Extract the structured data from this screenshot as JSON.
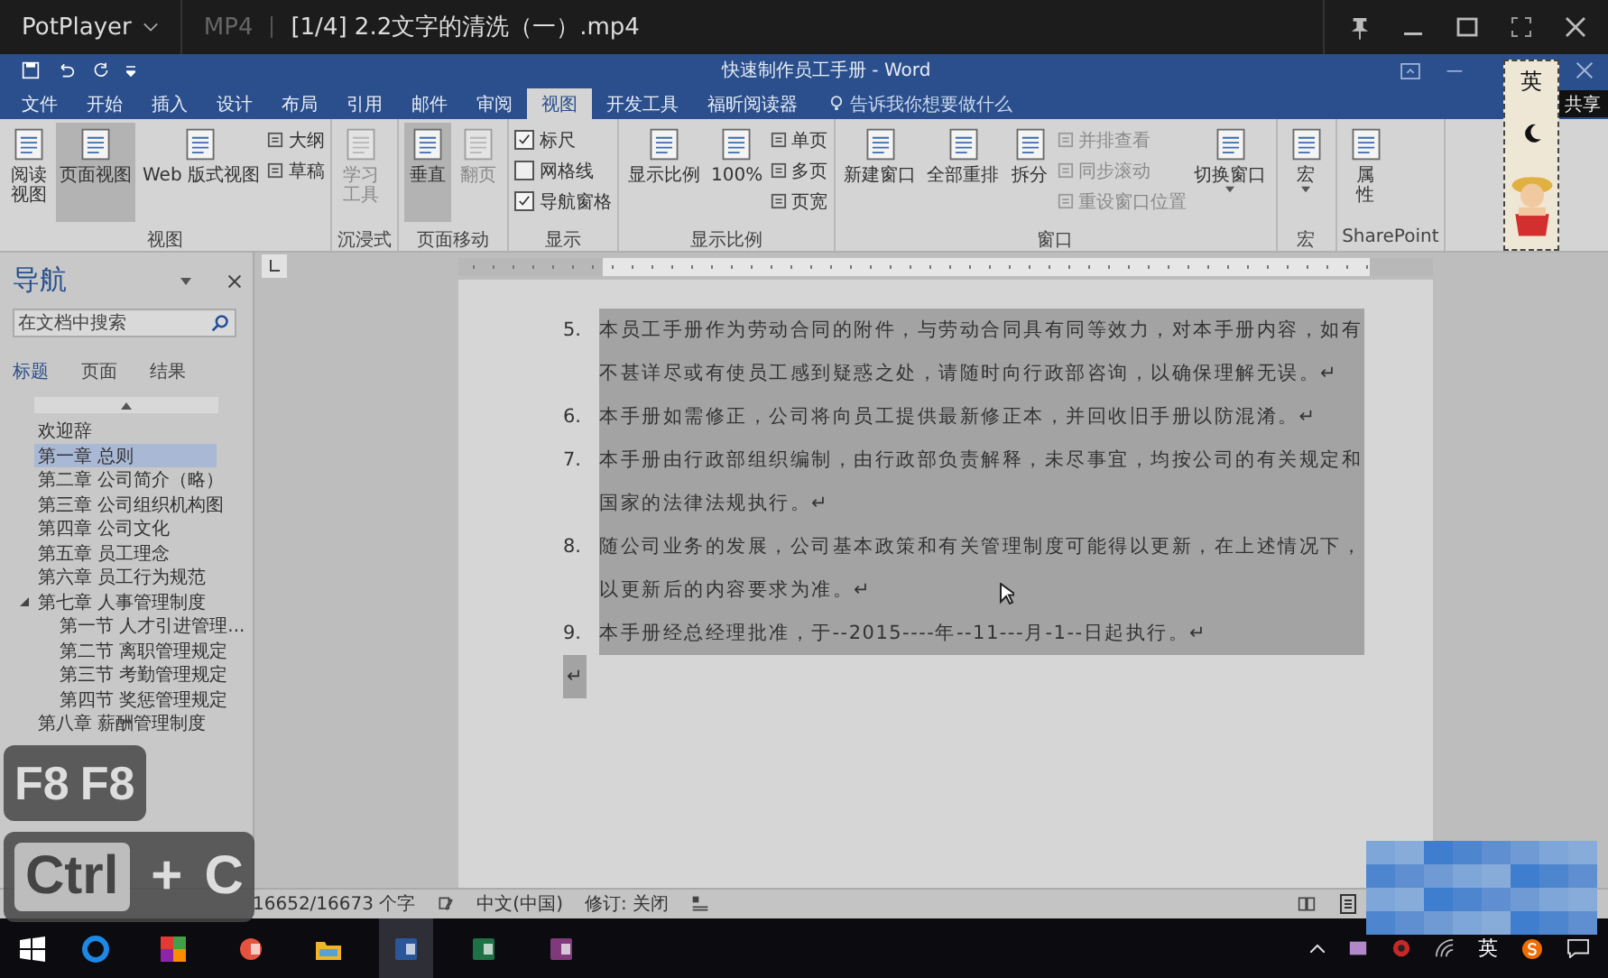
{
  "player": {
    "app": "PotPlayer",
    "format": "MP4",
    "file": "[1/4] 2.2文字的清洗（一）.mp4"
  },
  "word": {
    "title": "快速制作员工手册 - Word",
    "tell_me": "告诉我你想要做什么",
    "share": "共享",
    "tabs": [
      {
        "label": "文件",
        "selected": false
      },
      {
        "label": "开始",
        "selected": false
      },
      {
        "label": "插入",
        "selected": false
      },
      {
        "label": "设计",
        "selected": false
      },
      {
        "label": "布局",
        "selected": false
      },
      {
        "label": "引用",
        "selected": false
      },
      {
        "label": "邮件",
        "selected": false
      },
      {
        "label": "审阅",
        "selected": false
      },
      {
        "label": "视图",
        "selected": true
      },
      {
        "label": "开发工具",
        "selected": false
      },
      {
        "label": "福昕阅读器",
        "selected": false
      }
    ]
  },
  "ribbon": {
    "groups": [
      {
        "label": "视图",
        "items": [
          {
            "kind": "large",
            "lines": [
              "阅读",
              "视图"
            ],
            "selected": false,
            "disabled": false
          },
          {
            "kind": "large",
            "lines": [
              "页面视图"
            ],
            "selected": true,
            "disabled": false
          },
          {
            "kind": "large",
            "lines": [
              "Web 版式视图"
            ],
            "selected": false,
            "disabled": false
          },
          {
            "kind": "stack",
            "items": [
              {
                "kind": "small",
                "label": "大纲",
                "disabled": false
              },
              {
                "kind": "small",
                "label": "草稿",
                "disabled": false
              }
            ]
          }
        ]
      },
      {
        "label": "沉浸式",
        "items": [
          {
            "kind": "large",
            "lines": [
              "学习",
              "工具"
            ],
            "selected": false,
            "disabled": true
          }
        ]
      },
      {
        "label": "页面移动",
        "items": [
          {
            "kind": "large",
            "lines": [
              "垂直"
            ],
            "selected": true,
            "disabled": false
          },
          {
            "kind": "large",
            "lines": [
              "翻页"
            ],
            "selected": false,
            "disabled": true
          }
        ]
      },
      {
        "label": "显示",
        "items": [
          {
            "kind": "stack",
            "items": [
              {
                "kind": "check",
                "label": "标尺",
                "checked": true
              },
              {
                "kind": "check",
                "label": "网格线",
                "checked": false
              },
              {
                "kind": "check",
                "label": "导航窗格",
                "checked": true
              }
            ]
          }
        ]
      },
      {
        "label": "显示比例",
        "items": [
          {
            "kind": "large",
            "lines": [
              "显示比例"
            ],
            "selected": false,
            "disabled": false
          },
          {
            "kind": "large",
            "lines": [
              "100%"
            ],
            "selected": false,
            "disabled": false
          },
          {
            "kind": "stack",
            "items": [
              {
                "kind": "small",
                "label": "单页",
                "disabled": false
              },
              {
                "kind": "small",
                "label": "多页",
                "disabled": false
              },
              {
                "kind": "small",
                "label": "页宽",
                "disabled": false
              }
            ]
          }
        ]
      },
      {
        "label": "窗口",
        "items": [
          {
            "kind": "large",
            "lines": [
              "新建窗口"
            ],
            "selected": false,
            "disabled": false
          },
          {
            "kind": "large",
            "lines": [
              "全部重排"
            ],
            "selected": false,
            "disabled": false
          },
          {
            "kind": "large",
            "lines": [
              "拆分"
            ],
            "selected": false,
            "disabled": false
          },
          {
            "kind": "stack",
            "items": [
              {
                "kind": "small",
                "label": "并排查看",
                "disabled": true
              },
              {
                "kind": "small",
                "label": "同步滚动",
                "disabled": true
              },
              {
                "kind": "small",
                "label": "重设窗口位置",
                "disabled": true
              }
            ]
          },
          {
            "kind": "large",
            "lines": [
              "切换窗口"
            ],
            "selected": false,
            "disabled": false,
            "dropdown": true
          }
        ]
      },
      {
        "label": "宏",
        "items": [
          {
            "kind": "large",
            "lines": [
              "宏"
            ],
            "selected": false,
            "disabled": false,
            "dropdown": true
          }
        ]
      },
      {
        "label": "SharePoint",
        "items": [
          {
            "kind": "large",
            "lines": [
              "属",
              "性"
            ],
            "selected": false,
            "disabled": false
          }
        ]
      }
    ]
  },
  "navigation": {
    "title": "导航",
    "search": {
      "placeholder": "在文档中搜索"
    },
    "tabs": [
      {
        "label": "标题",
        "selected": true
      },
      {
        "label": "页面",
        "selected": false
      },
      {
        "label": "结果",
        "selected": false
      }
    ],
    "headings": [
      {
        "label": "欢迎辞",
        "selected": false
      },
      {
        "label": "第一章 总则",
        "selected": true
      },
      {
        "label": "第二章 公司简介（略）",
        "selected": false
      },
      {
        "label": "第三章 公司组织机构图",
        "selected": false
      },
      {
        "label": "第四章 公司文化",
        "selected": false
      },
      {
        "label": "第五章 员工理念",
        "selected": false
      },
      {
        "label": "第六章 员工行为规范",
        "selected": false
      },
      {
        "label": "第七章 人事管理制度",
        "selected": false,
        "expanded": true,
        "children": [
          {
            "label": "第一节 人才引进管理...",
            "selected": false
          },
          {
            "label": "第二节 离职管理规定",
            "selected": false
          },
          {
            "label": "第三节 考勤管理规定",
            "selected": false
          },
          {
            "label": "第四节 奖惩管理规定",
            "selected": false
          }
        ]
      },
      {
        "label": "第八章 薪酬管理制度",
        "selected": false
      }
    ]
  },
  "document": {
    "paragraphs": [
      {
        "number": "5.",
        "text": "本员工手册作为劳动合同的附件，与劳动合同具有同等效力，对本手册内容，如有不甚详尽或有使员工感到疑惑之处，请随时向行政部咨询，以确保理解无误。↵",
        "selected": true
      },
      {
        "number": "6.",
        "text": "本手册如需修正，公司将向员工提供最新修正本，并回收旧手册以防混淆。↵",
        "selected": true
      },
      {
        "number": "7.",
        "text": "本手册由行政部组织编制，由行政部负责解释，未尽事宜，均按公司的有关规定和国家的法律法规执行。↵",
        "selected": true
      },
      {
        "number": "8.",
        "text": "随公司业务的发展，公司基本政策和有关管理制度可能得以更新，在上述情况下，以更新后的内容要求为准。↵",
        "selected": true
      },
      {
        "number": "9.",
        "text": "本手册经总经理批准，于--2015----年--11---月-1--日起执行。↵",
        "selected": true
      }
    ],
    "end_mark": {
      "text": "↵",
      "selected": true
    }
  },
  "status_bar": {
    "word_count": "16652/16673 个字",
    "language": "中文(中国)",
    "track_changes": "修订: 关闭"
  },
  "ime": {
    "mode": "英"
  },
  "key_overlays": [
    {
      "keys": [
        {
          "text": "F8",
          "boxed": false
        },
        {
          "text": "F8",
          "boxed": false
        }
      ]
    },
    {
      "keys": [
        {
          "text": "Ctrl",
          "boxed": true
        },
        {
          "text": "+",
          "boxed": false
        },
        {
          "text": "C",
          "boxed": false
        }
      ]
    }
  ],
  "taskbar": {
    "apps": [
      {
        "selected": false
      },
      {
        "selected": false
      },
      {
        "selected": false
      },
      {
        "selected": false
      },
      {
        "selected": true
      },
      {
        "selected": false
      },
      {
        "selected": false
      }
    ],
    "tray_language": "英"
  }
}
